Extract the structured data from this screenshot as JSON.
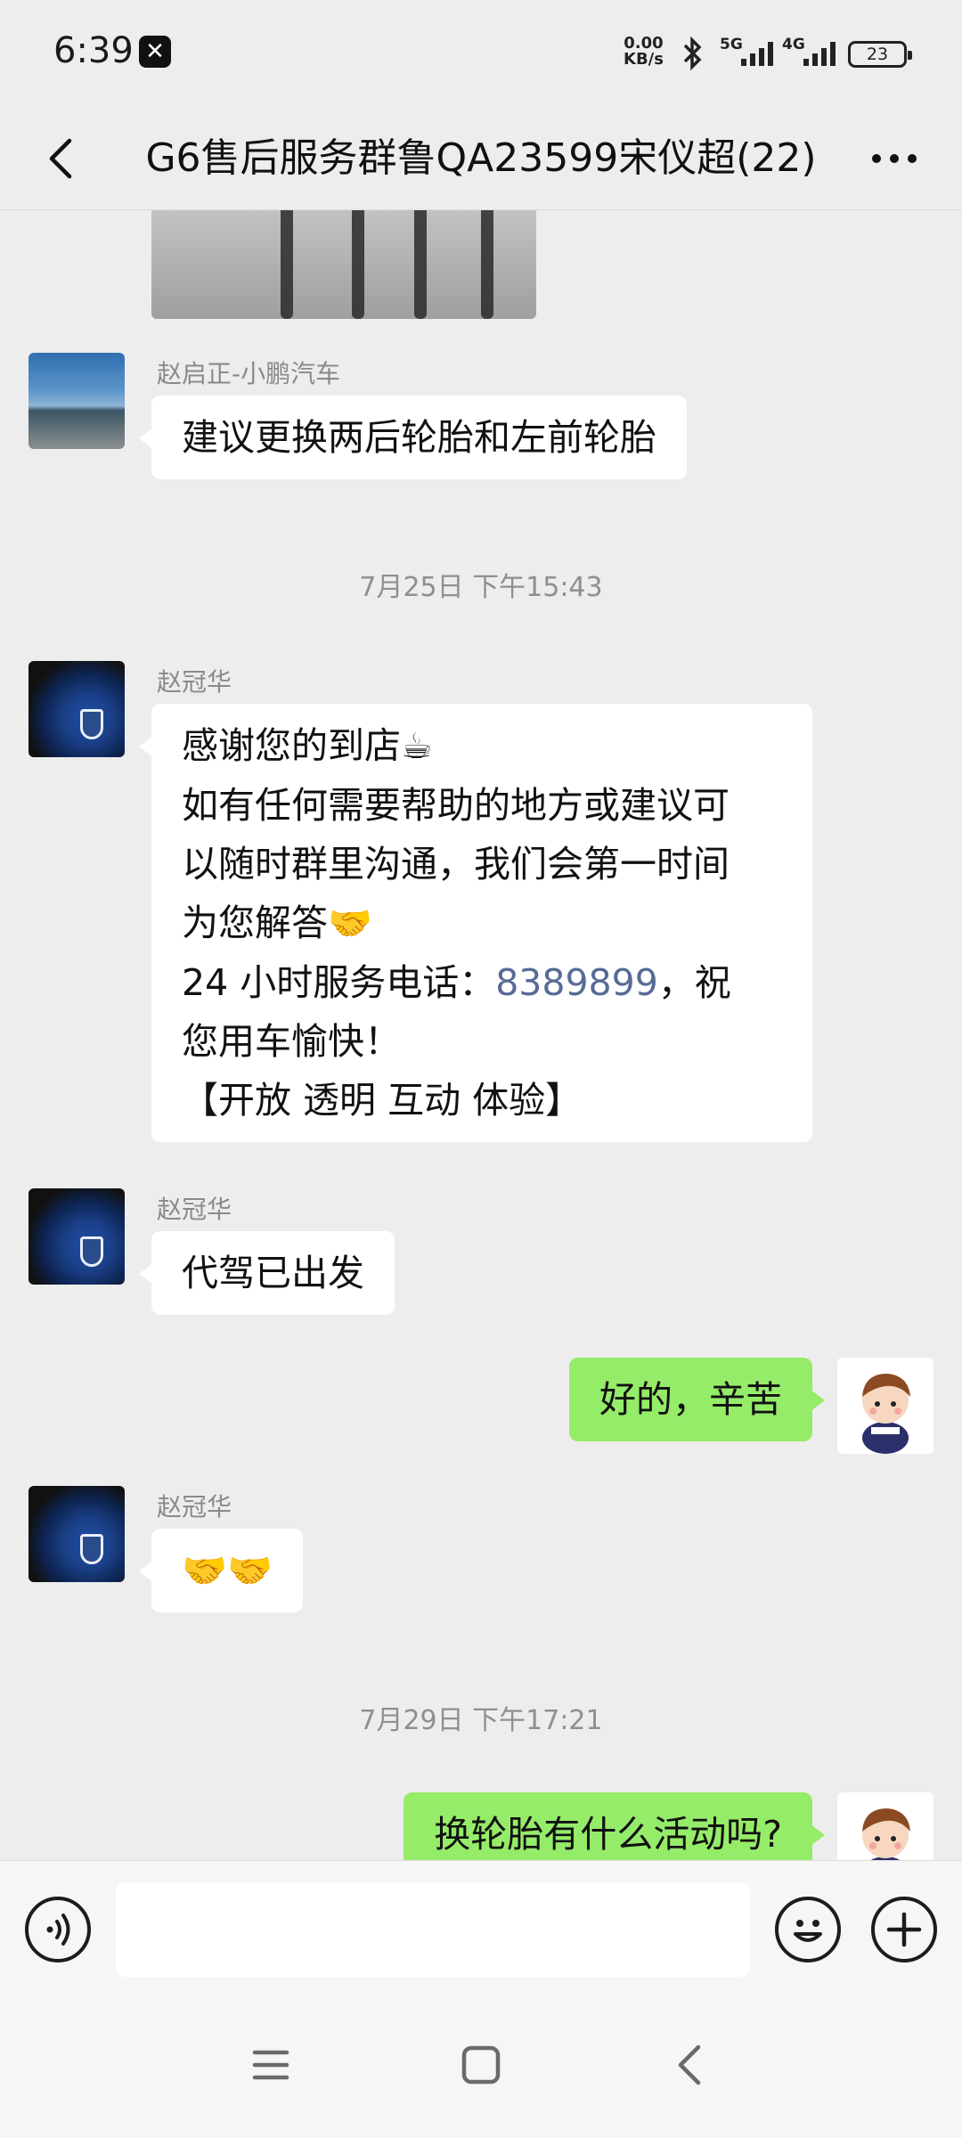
{
  "status_bar": {
    "time": "6:39",
    "net_speed_value": "0.00",
    "net_speed_unit": "KB/s",
    "signal_1": "5G",
    "signal_2": "4G",
    "battery": "23"
  },
  "header": {
    "title": "G6售后服务群鲁QA23599宋仪超(22)"
  },
  "messages": [
    {
      "sender": "赵启正-小鹏汽车",
      "text": "建议更换两后轮胎和左前轮胎"
    },
    {
      "timestamp": "7月25日 下午15:43"
    },
    {
      "sender": "赵冠华",
      "lines": [
        "感谢您的到店",
        "如有任何需要帮助的地方或建议可",
        "以随时群里沟通，我们会第一时间",
        "为您解答",
        "24 小时服务电话：",
        "8389899",
        "，祝",
        "您用车愉快！",
        "【开放 透明 互动 体验】"
      ],
      "emoji_coffee": "☕",
      "emoji_handshake": "🤝"
    },
    {
      "sender": "赵冠华",
      "text": "代驾已出发"
    },
    {
      "sender": "me",
      "text": "好的，辛苦"
    },
    {
      "sender": "赵冠华",
      "text": "🤝🤝"
    },
    {
      "timestamp": "7月29日 下午17:21"
    },
    {
      "sender": "me",
      "text": "换轮胎有什么活动吗?"
    }
  ],
  "input": {
    "value": "",
    "placeholder": ""
  },
  "colors": {
    "my_bubble": "#95ec69",
    "background": "#ededed",
    "link": "#576b95"
  },
  "icons": {
    "voice": "voice-icon",
    "emoji": "emoji-icon",
    "plus": "plus-icon",
    "back": "back-icon",
    "more": "more-icon"
  }
}
